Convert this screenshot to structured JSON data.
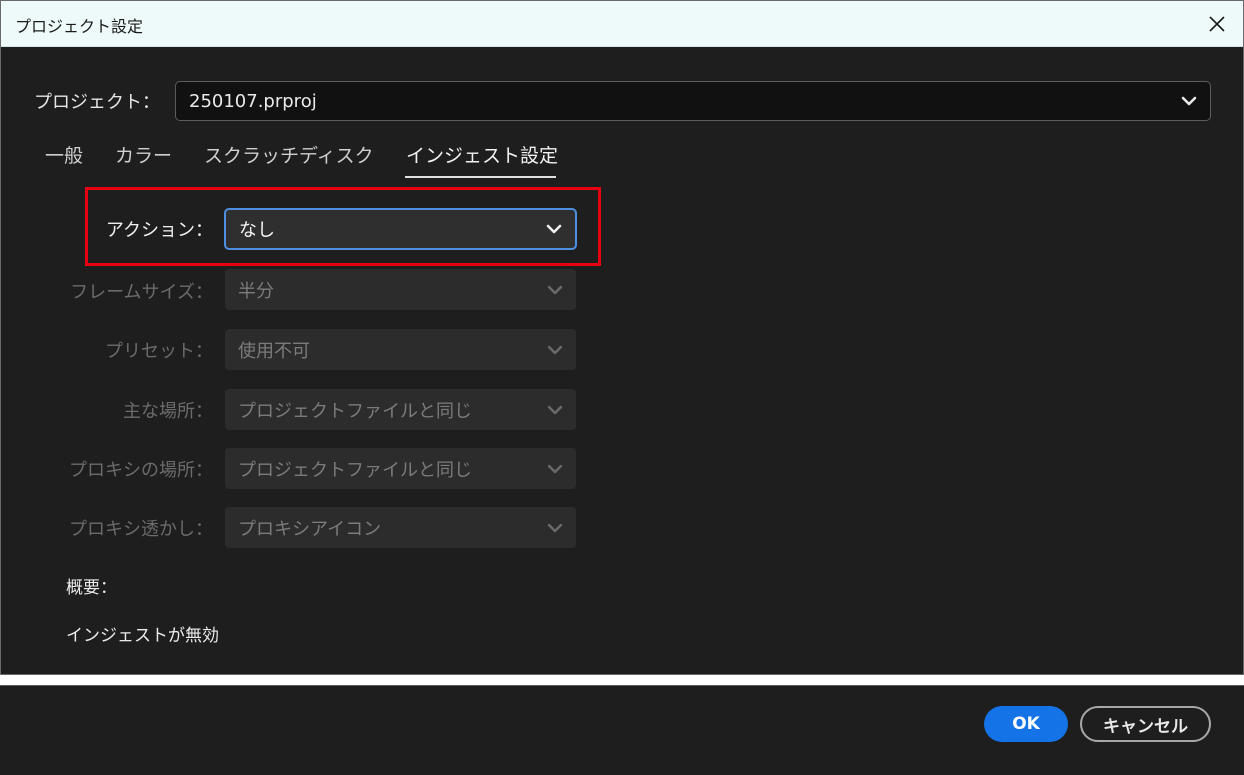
{
  "window": {
    "title": "プロジェクト設定"
  },
  "project": {
    "label": "プロジェクト：",
    "value": "250107.prproj"
  },
  "tabs": [
    {
      "label": "一般",
      "active": false
    },
    {
      "label": "カラー",
      "active": false
    },
    {
      "label": "スクラッチディスク",
      "active": false
    },
    {
      "label": "インジェスト設定",
      "active": true
    }
  ],
  "settings": {
    "action": {
      "label": "アクション：",
      "value": "なし",
      "enabled": true
    },
    "frame_size": {
      "label": "フレームサイズ：",
      "value": "半分",
      "enabled": false
    },
    "preset": {
      "label": "プリセット：",
      "value": "使用不可",
      "enabled": false
    },
    "primary_location": {
      "label": "主な場所：",
      "value": "プロジェクトファイルと同じ",
      "enabled": false
    },
    "proxy_location": {
      "label": "プロキシの場所：",
      "value": "プロジェクトファイルと同じ",
      "enabled": false
    },
    "proxy_watermark": {
      "label": "プロキシ透かし：",
      "value": "プロキシアイコン",
      "enabled": false
    }
  },
  "summary": {
    "label": "概要：",
    "text": "インジェストが無効"
  },
  "buttons": {
    "ok": "OK",
    "cancel": "キャンセル"
  },
  "colors": {
    "accent": "#1473e6",
    "focus_border": "#4d8fe0",
    "highlight": "#e60012"
  },
  "icons": {
    "close": "close-icon",
    "dropdown": "chevron-down-icon"
  }
}
